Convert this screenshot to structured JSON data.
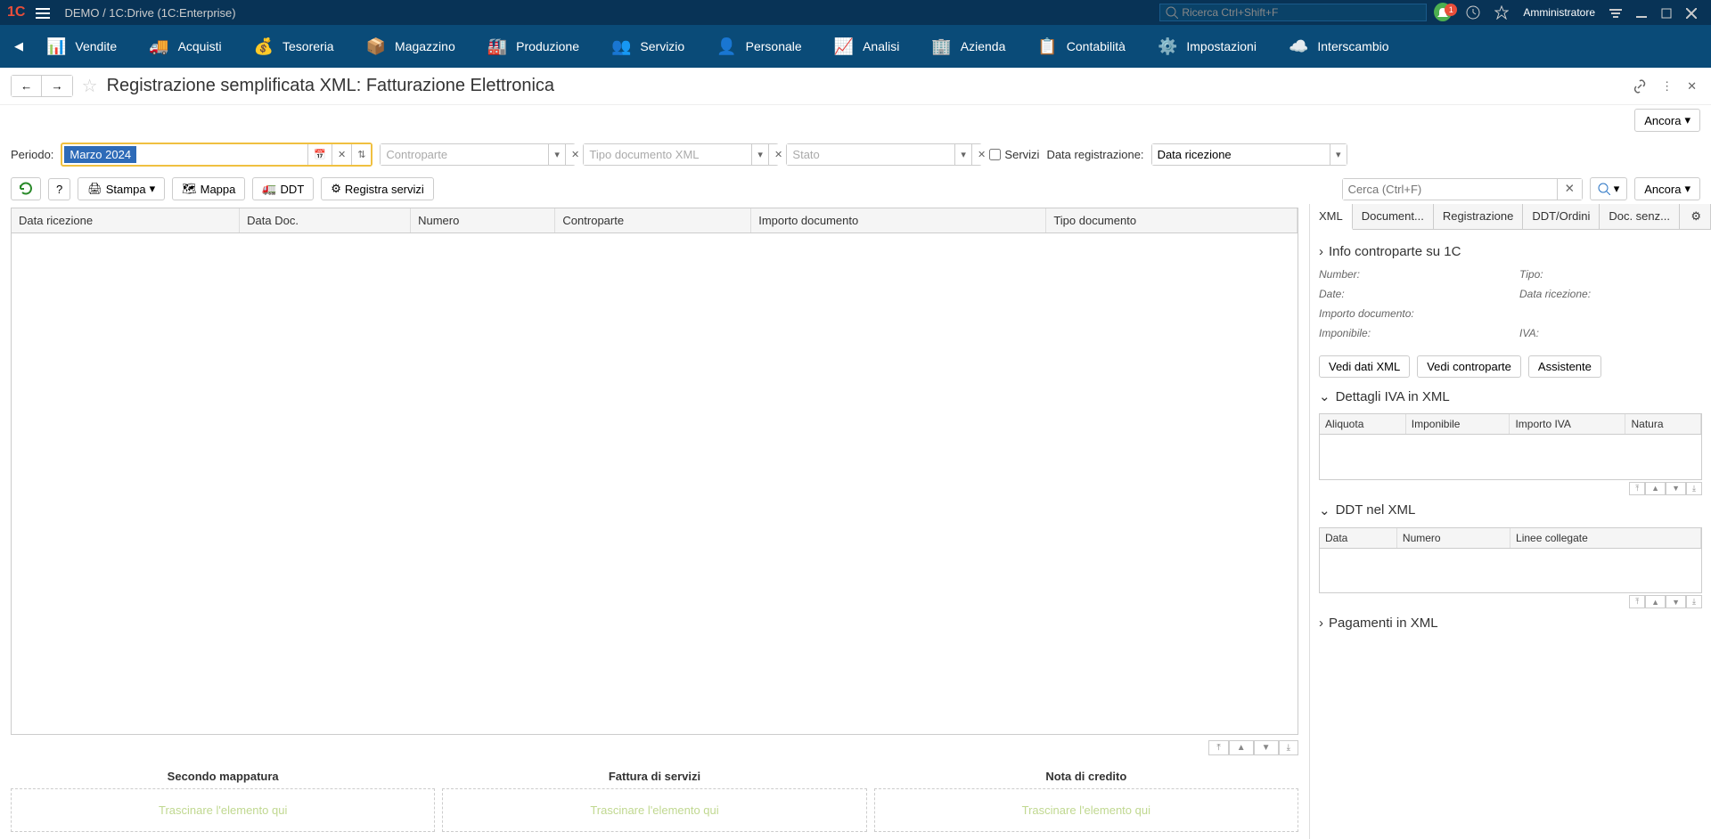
{
  "titlebar": {
    "app_title": "DEMO / 1C:Drive  (1C:Enterprise)",
    "search_placeholder": "Ricerca Ctrl+Shift+F",
    "bell_count": "1",
    "user_label": "Amministratore"
  },
  "mainnav": {
    "items": [
      {
        "label": "Vendite",
        "icon": "📊"
      },
      {
        "label": "Acquisti",
        "icon": "🚚"
      },
      {
        "label": "Tesoreria",
        "icon": "💰"
      },
      {
        "label": "Magazzino",
        "icon": "📦"
      },
      {
        "label": "Produzione",
        "icon": "🏭"
      },
      {
        "label": "Servizio",
        "icon": "👥"
      },
      {
        "label": "Personale",
        "icon": "👤"
      },
      {
        "label": "Analisi",
        "icon": "📈"
      },
      {
        "label": "Azienda",
        "icon": "🏢"
      },
      {
        "label": "Contabilità",
        "icon": "📋"
      },
      {
        "label": "Impostazioni",
        "icon": "⚙️"
      },
      {
        "label": "Interscambio",
        "icon": "☁️"
      }
    ]
  },
  "page": {
    "title": "Registrazione semplificata XML: Fatturazione Elettronica",
    "ancora_btn": "Ancora"
  },
  "filters": {
    "periodo_label": "Periodo:",
    "periodo_value": "Marzo 2024",
    "controparte_placeholder": "Controparte",
    "tipo_doc_placeholder": "Tipo documento XML",
    "stato_placeholder": "Stato",
    "servizi_label": "Servizi",
    "data_reg_label": "Data registrazione:",
    "data_reg_value": "Data ricezione"
  },
  "toolbar": {
    "help": "?",
    "stampa": "Stampa",
    "mappa": "Mappa",
    "ddt": "DDT",
    "registra": "Registra servizi",
    "search_placeholder": "Cerca (Ctrl+F)",
    "ancora": "Ancora"
  },
  "table": {
    "columns": [
      "Data ricezione",
      "Data Doc.",
      "Numero",
      "Controparte",
      "Importo documento",
      "Tipo documento"
    ]
  },
  "dropzones": [
    {
      "title": "Secondo mappatura",
      "hint": "Trascinare l'elemento qui"
    },
    {
      "title": "Fattura di servizi",
      "hint": "Trascinare l'elemento qui"
    },
    {
      "title": "Nota di credito",
      "hint": "Trascinare l'elemento qui"
    }
  ],
  "rightpanel": {
    "tabs": [
      "XML",
      "Document...",
      "Registrazione",
      "DDT/Ordini",
      "Doc. senz..."
    ],
    "info_hdr": "Info controparte su 1C",
    "fields": {
      "number": "Number:",
      "tipo": "Tipo:",
      "date": "Date:",
      "data_ric": "Data ricezione:",
      "importo": "Importo documento:",
      "imponibile": "Imponibile:",
      "iva": "IVA:"
    },
    "btns": {
      "vedi_xml": "Vedi dati XML",
      "vedi_ctrp": "Vedi controparte",
      "assistente": "Assistente"
    },
    "dettagli_iva_hdr": "Dettagli IVA in XML",
    "iva_cols": [
      "Aliquota",
      "Imponibile",
      "Importo IVA",
      "Natura"
    ],
    "ddt_hdr": "DDT nel XML",
    "ddt_cols": [
      "Data",
      "Numero",
      "Linee collegate"
    ],
    "pagamenti_hdr": "Pagamenti in XML"
  }
}
